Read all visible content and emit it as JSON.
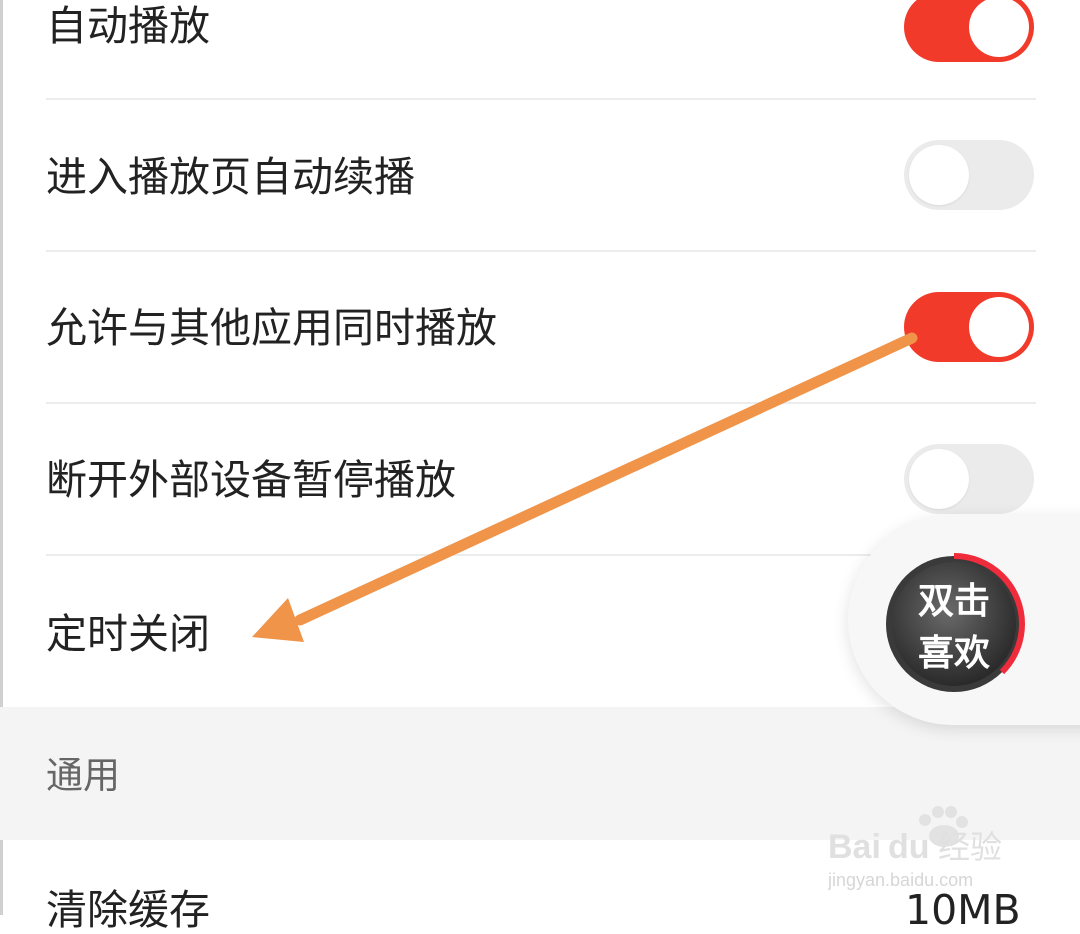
{
  "settings": {
    "rows": [
      {
        "label": "自动播放",
        "toggle": "on"
      },
      {
        "label": "进入播放页自动续播",
        "toggle": "off"
      },
      {
        "label": "允许与其他应用同时播放",
        "toggle": "on"
      },
      {
        "label": "断开外部设备暂停播放",
        "toggle": "off"
      },
      {
        "label": "定时关闭"
      }
    ],
    "section_general": "通用",
    "clear_cache": {
      "label": "清除缓存",
      "value": "10MB"
    }
  },
  "floating_like": {
    "line1": "双击",
    "line2": "喜欢"
  },
  "annotation": {
    "arrow_color": "#f0944a"
  },
  "watermark": {
    "brand": "Bai du 经验",
    "url": "jingyan.baidu.com"
  },
  "colors": {
    "toggle_on": "#f23a2a",
    "toggle_off": "#ebebeb",
    "divider": "#ececec",
    "section_bg": "#f4f4f4"
  }
}
